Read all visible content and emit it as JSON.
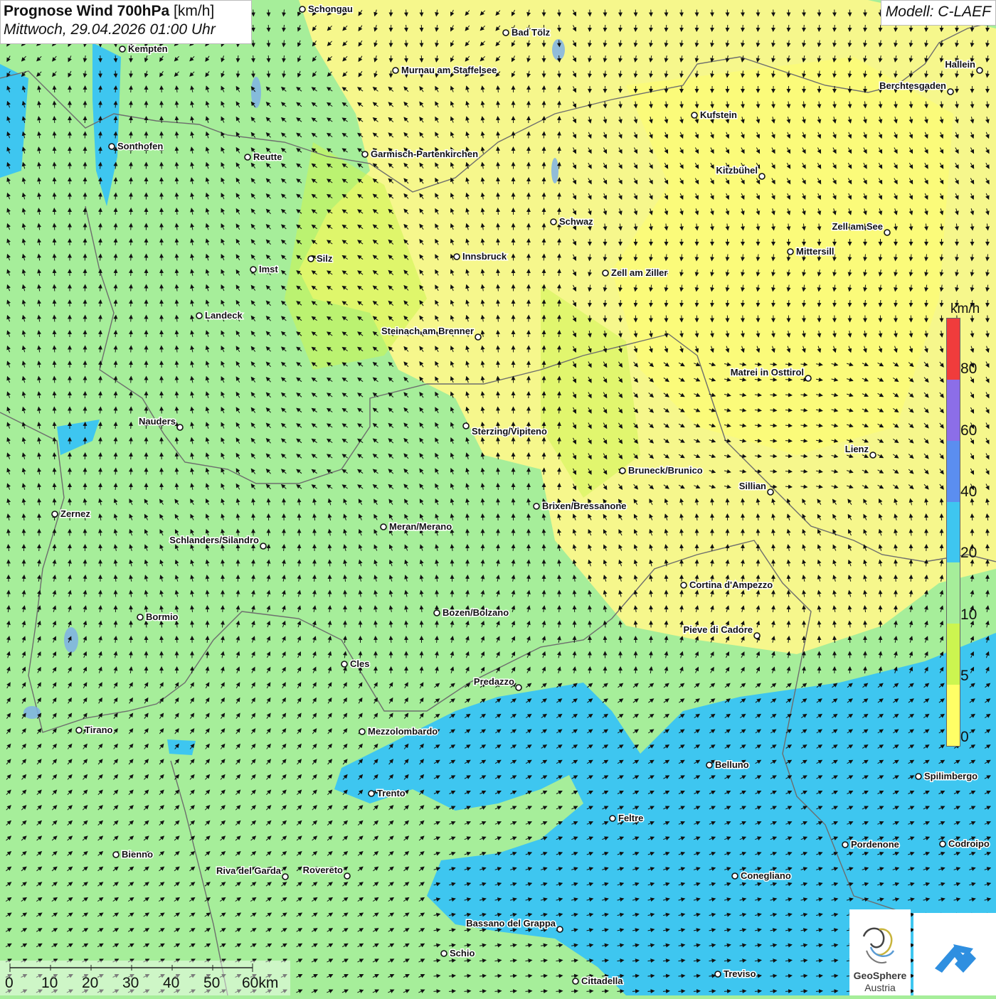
{
  "title": {
    "bold": "Prognose Wind 700hPa",
    "unit": "[km/h]",
    "datetime": "Mittwoch, 29.04.2026 01:00 Uhr"
  },
  "model": "Modell: C-LAEF",
  "legend": {
    "unit": "km/h",
    "levels": [
      "0",
      "5",
      "10",
      "20",
      "40",
      "60",
      "80"
    ],
    "colors": [
      "#ffff66",
      "#ccf550",
      "#a6ee9a",
      "#3ec6f0",
      "#5b8ef0",
      "#8c6ee8",
      "#f03c3c"
    ]
  },
  "scalebar": {
    "labels": [
      "0",
      "10",
      "20",
      "30",
      "40",
      "50",
      "60km"
    ]
  },
  "logos": {
    "geosphere_line1": "GeoSphere",
    "geosphere_line2": "Austria"
  },
  "cities": [
    {
      "name": "Schongau"
    },
    {
      "name": "Bad Tölz"
    },
    {
      "name": "Kempten"
    },
    {
      "name": "Murnau am Staffelsee"
    },
    {
      "name": "Hallein"
    },
    {
      "name": "Berchtesgaden"
    },
    {
      "name": "Kufstein"
    },
    {
      "name": "Sonthofen"
    },
    {
      "name": "Reutte"
    },
    {
      "name": "Garmisch-Partenkirchen"
    },
    {
      "name": "Kitzbühel"
    },
    {
      "name": "Schwaz"
    },
    {
      "name": "Zell am See"
    },
    {
      "name": "Mittersill"
    },
    {
      "name": "Innsbruck"
    },
    {
      "name": "Silz"
    },
    {
      "name": "Imst"
    },
    {
      "name": "Zell am Ziller"
    },
    {
      "name": "Landeck"
    },
    {
      "name": "Steinach am Brenner"
    },
    {
      "name": "Matrei in Osttirol"
    },
    {
      "name": "Nauders"
    },
    {
      "name": "Sterzing/Vipiteno"
    },
    {
      "name": "Lienz"
    },
    {
      "name": "Bruneck/Brunico"
    },
    {
      "name": "Sillian"
    },
    {
      "name": "Zernez"
    },
    {
      "name": "Brixen/Bressanone"
    },
    {
      "name": "Meran/Merano"
    },
    {
      "name": "Schlanders/Silandro"
    },
    {
      "name": "Cortina d'Ampezzo"
    },
    {
      "name": "Bozen/Bolzano"
    },
    {
      "name": "Bormio"
    },
    {
      "name": "Pieve di Cadore"
    },
    {
      "name": "Cles"
    },
    {
      "name": "Predazzo"
    },
    {
      "name": "Tirano"
    },
    {
      "name": "Mezzolombardo"
    },
    {
      "name": "Belluno"
    },
    {
      "name": "Spilimbergo"
    },
    {
      "name": "Trento"
    },
    {
      "name": "Feltre"
    },
    {
      "name": "Pordenone"
    },
    {
      "name": "Codroipo"
    },
    {
      "name": "Bienno"
    },
    {
      "name": "Riva del Garda"
    },
    {
      "name": "Rovereto"
    },
    {
      "name": "Conegliano"
    },
    {
      "name": "Bassano del Grappa"
    },
    {
      "name": "Schio"
    },
    {
      "name": "Treviso"
    },
    {
      "name": "Cittadella"
    }
  ]
}
